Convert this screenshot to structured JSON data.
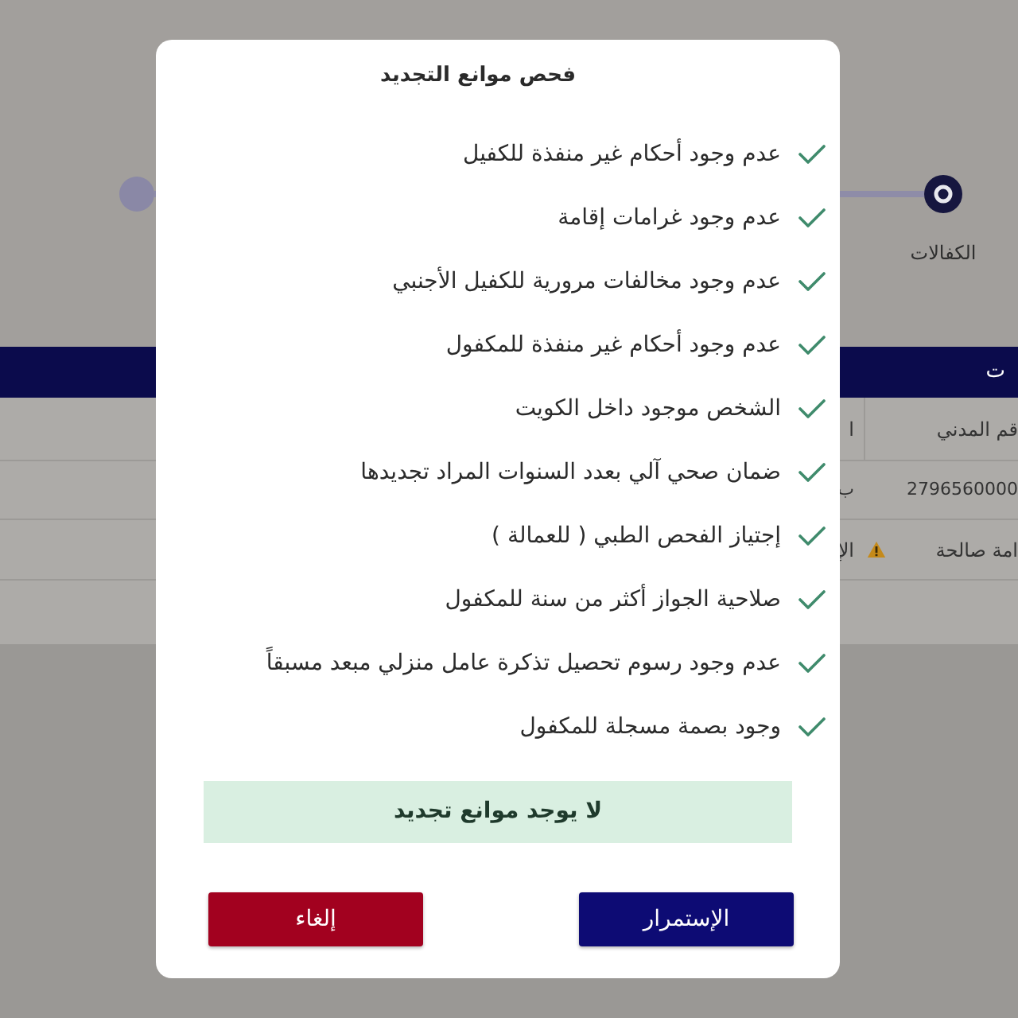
{
  "stepper": {
    "steps": [
      {
        "label": "الكفالات",
        "selected": true
      },
      {
        "selected": false
      }
    ]
  },
  "section": {
    "title": "ت"
  },
  "table": {
    "columns": [
      "قم المدني",
      "ا"
    ],
    "rows": [
      [
        {
          "text": "2796560000",
          "warning": false
        },
        {
          "text": "ب",
          "warning": false
        }
      ],
      [
        {
          "text": "امة صالحة",
          "warning": true
        },
        {
          "text": "الإ",
          "warning": false
        }
      ]
    ]
  },
  "dialog": {
    "title": "فحص موانع التجديد",
    "checks": [
      {
        "label": "عدم وجود أحكام غير منفذة للكفيل",
        "passed": true
      },
      {
        "label": "عدم وجود غرامات إقامة",
        "passed": true
      },
      {
        "label": "عدم وجود مخالفات مرورية للكفيل الأجنبي",
        "passed": true
      },
      {
        "label": "عدم وجود أحكام غير منفذة للمكفول",
        "passed": true
      },
      {
        "label": "الشخص موجود داخل الكويت",
        "passed": true
      },
      {
        "label": "ضمان صحي آلي بعدد السنوات المراد تجديدها",
        "passed": true
      },
      {
        "label": "إجتياز الفحص الطبي ( للعمالة )",
        "passed": true
      },
      {
        "label": "صلاحية الجواز أكثر من سنة للمكفول",
        "passed": true
      },
      {
        "label": "عدم وجود رسوم تحصيل تذكرة عامل منزلي مبعد مسبقاً",
        "passed": true
      },
      {
        "label": "وجود بصمة مسجلة للمكفول",
        "passed": true
      }
    ],
    "notice": "لا يوجد موانع تجديد",
    "buttons": [
      {
        "label": "الإستمرار",
        "kind": "primary"
      },
      {
        "label": "إلغاء",
        "kind": "danger"
      }
    ]
  }
}
